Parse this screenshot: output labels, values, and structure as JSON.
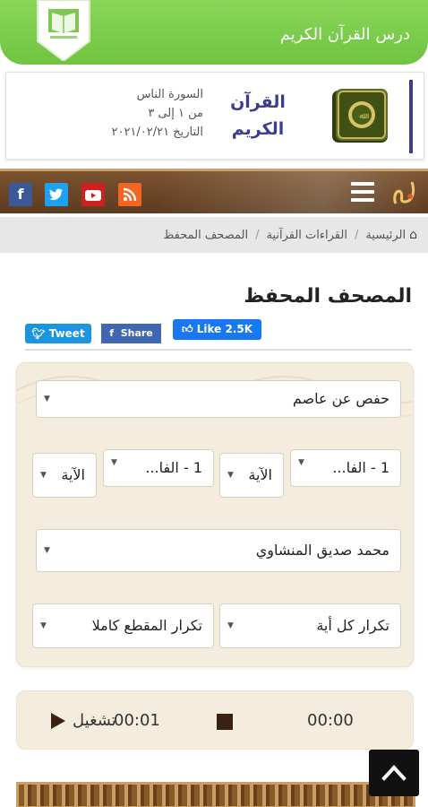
{
  "header": {
    "title": "درس القرآن الكريم",
    "logo_icon": "quran-book-logo-icon",
    "colors": {
      "banner": "#74c846"
    }
  },
  "lesson_card": {
    "book_title_line1": "القرآن",
    "book_title_line2": "الكريم",
    "surah": "السورة  الناس",
    "range": "من  ١  إلى  ٣",
    "date": "التاريخ  ٢٠٢١/٠٢/٢١",
    "book_icon": "quran-cover-icon"
  },
  "nav": {
    "menu_icon": "hamburger-menu-icon",
    "social": [
      {
        "name": "facebook-icon",
        "glyph": "f",
        "color": "#3b5998"
      },
      {
        "name": "twitter-icon",
        "glyph": "t",
        "color": "#1da1f2"
      },
      {
        "name": "youtube-icon",
        "glyph": "▶",
        "color": "#cd201f"
      },
      {
        "name": "rss-icon",
        "glyph": ")",
        "color": "#f26522"
      }
    ]
  },
  "breadcrumb": {
    "home": "الرئيسية",
    "section": "القراءات القرآنية",
    "current": "المصحف المحفظ"
  },
  "page_title": "المصحف المحفظ",
  "share": {
    "tweet": "Tweet",
    "share": "Share",
    "like": "Like 2.5K"
  },
  "settings": {
    "riwaya": "حفص عن عاصم",
    "from_surah": "1 - الفا...",
    "from_ayah": "الآية",
    "to_surah": "1 - الفا...",
    "to_ayah": "الآية",
    "reciter": "محمد صديق المنشاوي",
    "repeat_ayah": "تكرار كل أية",
    "repeat_section": "تكرار المقطع كاملا"
  },
  "player": {
    "current_time": "00:00",
    "total_time": "00:01",
    "play_label": "تشغيل",
    "stop_icon": "stop-icon",
    "play_icon": "play-icon"
  },
  "back_to_top_icon": "chevron-up-icon"
}
